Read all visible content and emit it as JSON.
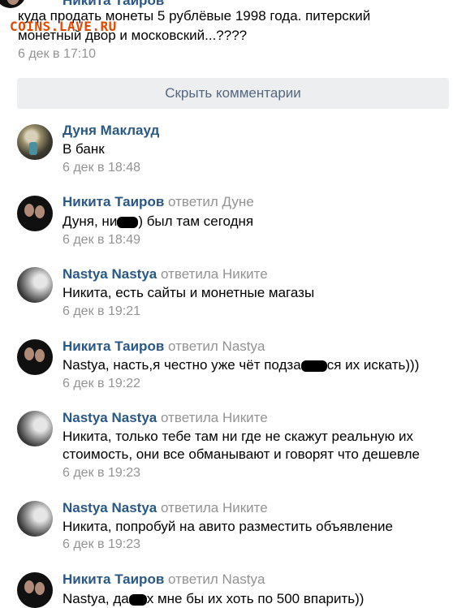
{
  "top": {
    "author": "Никита Таиров",
    "text_line1": "куда продать монеты 5 рублёвые 1998 года. питерский",
    "text_line2": "монетный двор и московский...????",
    "date": "6 дек в 17:10"
  },
  "watermark": "COINS.LAVE.RU",
  "hide_button": "Скрыть комментарии",
  "comments": [
    {
      "author": "Дуня Маклауд",
      "reply": "",
      "lines": [
        "В банк"
      ],
      "date": "6 дек в 18:48"
    },
    {
      "author": "Никита Таиров",
      "reply": "ответил Дуне",
      "lines": [
        "Дуня, ни",
        ") был там сегодня"
      ],
      "date": "6 дек в 18:49"
    },
    {
      "author": "Nastya Nastya",
      "reply": "ответила Никите",
      "lines": [
        "Никита, есть сайты и монетные магазы"
      ],
      "date": "6 дек в 19:21"
    },
    {
      "author": "Никита Таиров",
      "reply": "ответил Nastya",
      "lines": [
        "Nastya, насть,я честно уже чёт подза",
        "ся их искать)))"
      ],
      "date": "6 дек в 19:22"
    },
    {
      "author": "Nastya Nastya",
      "reply": "ответила Никите",
      "lines": [
        "Никита, только тебе там ни где не скажут реальную их",
        "стоимость, они все обманывают и говорят что дешевле"
      ],
      "date": "6 дек в 19:23"
    },
    {
      "author": "Nastya Nastya",
      "reply": "ответила Никите",
      "lines": [
        "Никита, попробуй на авито разместить объявление"
      ],
      "date": "6 дек в 19:23"
    },
    {
      "author": "Никита Таиров",
      "reply": "ответил Nastya",
      "lines": [
        "Nastya, да",
        "х мне бы их хоть по 500 впарить))"
      ],
      "date": ""
    }
  ]
}
